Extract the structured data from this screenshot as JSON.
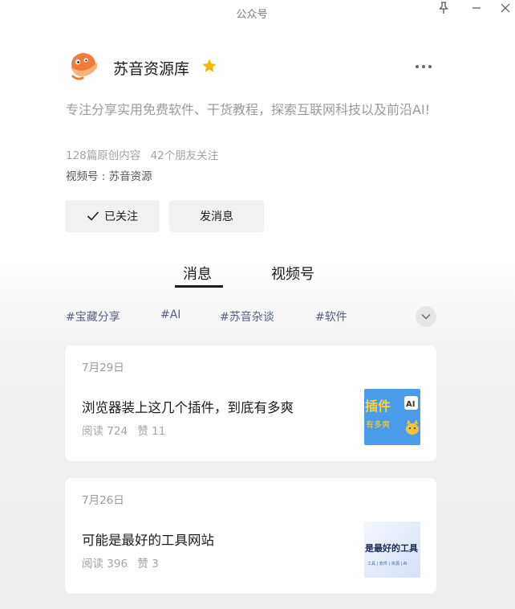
{
  "window": {
    "title": "公众号",
    "pin_icon": "pin-icon",
    "minimize_icon": "minimize-icon",
    "close_icon": "close-icon"
  },
  "profile": {
    "name": "苏音资源库",
    "star_icon": "star-icon",
    "star_color": "#f5b800",
    "description": "专注分享实用免费软件、干货教程，探索互联网科技以及前沿AI!",
    "original_count": "128篇原创内容",
    "friends_following": "42个朋友关注",
    "channel": "视频号 : 苏音资源",
    "more_icon": "more-icon"
  },
  "actions": {
    "follow_label": "已关注",
    "message_label": "发消息"
  },
  "tabs": [
    {
      "label": "消息",
      "active": true
    },
    {
      "label": "视频号",
      "active": false
    }
  ],
  "tags": [
    "#宝藏分享",
    "#AI",
    "#苏音杂谈",
    "#软件"
  ],
  "articles": [
    {
      "date": "7月29日",
      "title": "浏览器装上这几个插件，到底有多爽",
      "reads": "阅读 724",
      "likes": "赞 11",
      "thumb_text_top": "插件",
      "thumb_text_bottom": "有多爽",
      "thumb_bg": "#4a9be8"
    },
    {
      "date": "7月26日",
      "title": "可能是最好的工具网站",
      "reads": "阅读 396",
      "likes": "赞 3",
      "thumb_text_top": "是最好的工具",
      "thumb_text_bottom": "工具 | 软件 | 资源 | AI",
      "thumb_bg": "#e4ecfb"
    }
  ],
  "colors": {
    "tag_text": "#556080",
    "muted_text": "#a3a3a3"
  }
}
